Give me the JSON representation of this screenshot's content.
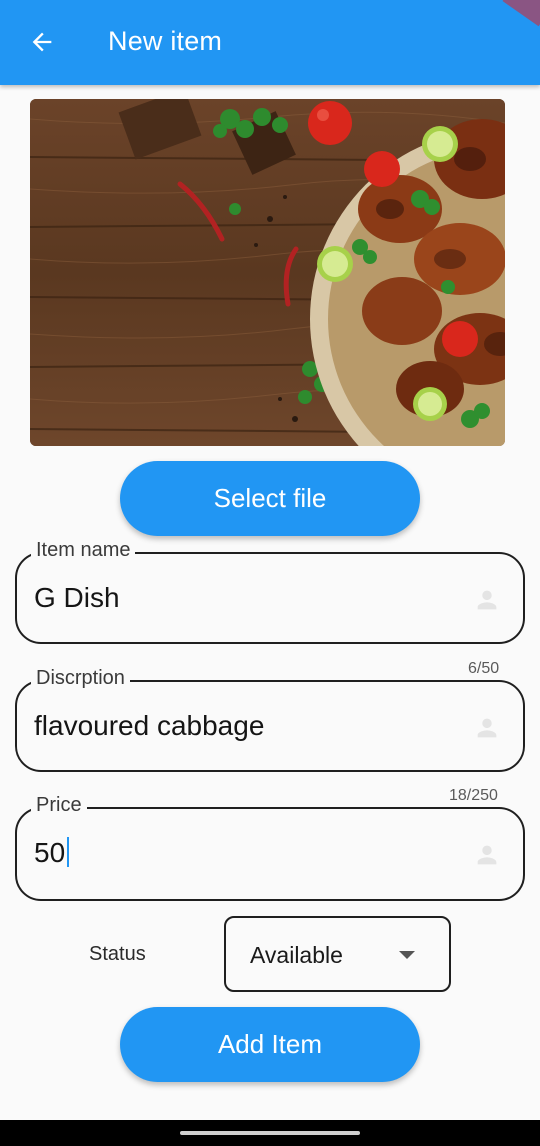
{
  "appbar": {
    "title": "New item",
    "back_icon": "arrow-back-icon",
    "color": "#2196f3"
  },
  "image": {
    "description_icon": "food-photo"
  },
  "select_file_button": {
    "label": "Select file"
  },
  "form": {
    "item_name": {
      "label": "Item name",
      "value": "G Dish",
      "icon": "person-icon"
    },
    "description": {
      "label": "Discrption",
      "value": "flavoured cabbage",
      "counter": "6/50",
      "icon": "person-icon"
    },
    "price": {
      "label": "Price",
      "value": "50",
      "counter": "18/250",
      "icon": "person-icon"
    },
    "status": {
      "label": "Status",
      "selected": "Available",
      "icon": "dropdown-arrow-icon"
    }
  },
  "add_item_button": {
    "label": "Add Item"
  },
  "colors": {
    "primary": "#2196f3",
    "background": "#fafafa",
    "border": "#1f1f1f"
  }
}
